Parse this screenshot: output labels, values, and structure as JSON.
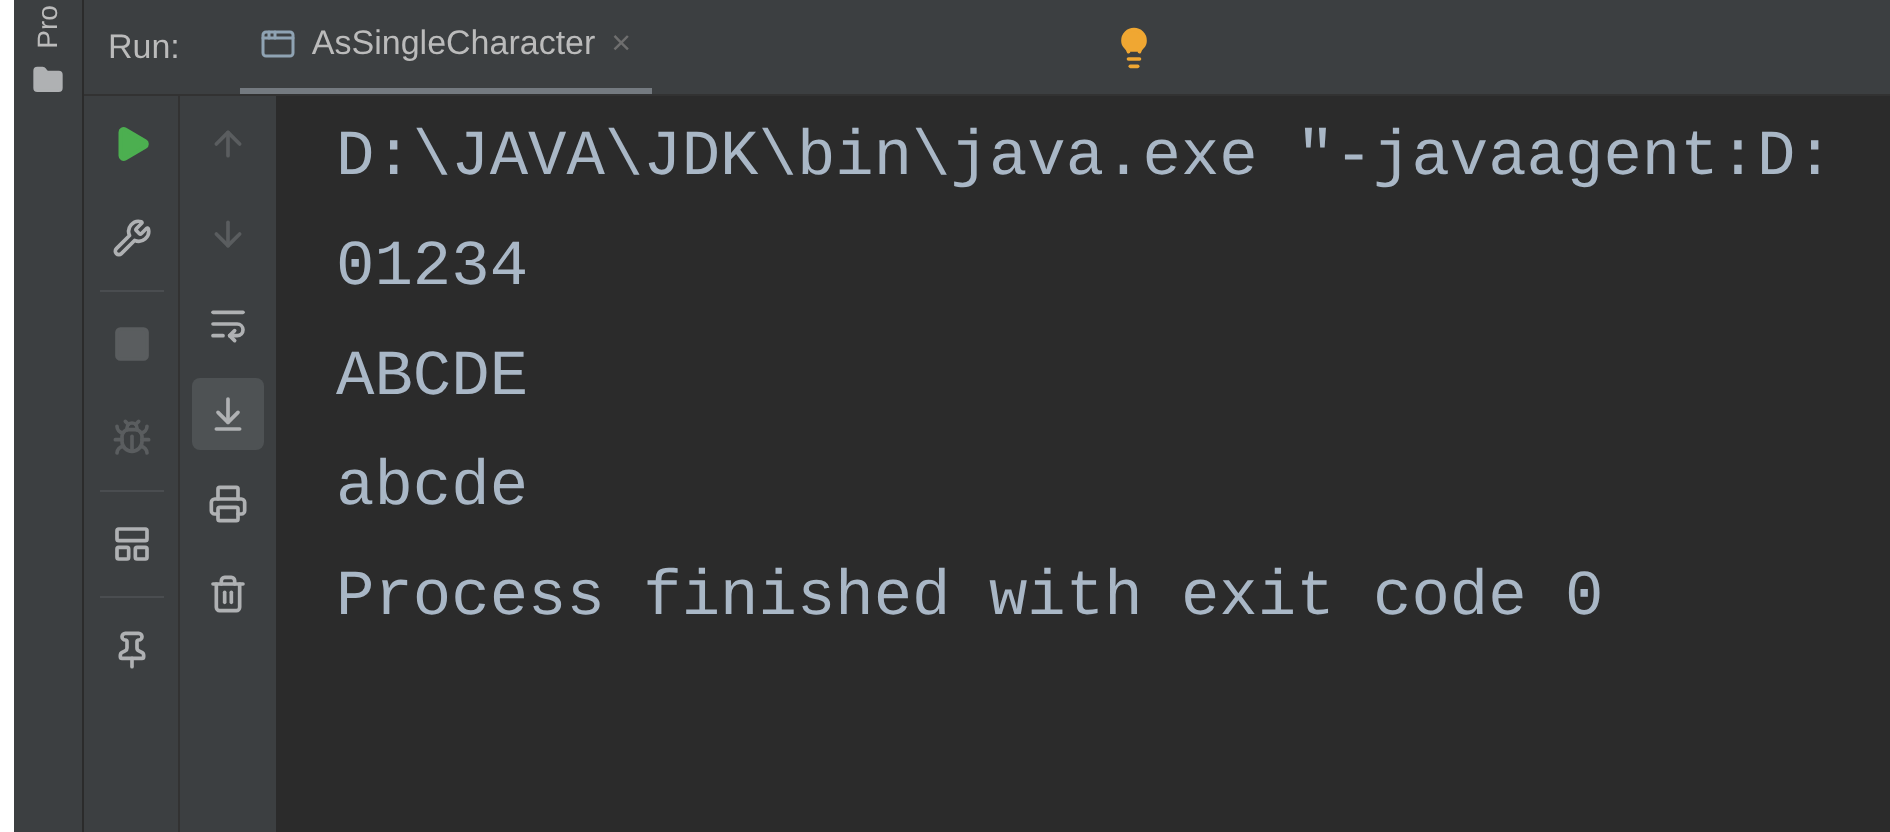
{
  "side_strip": {
    "label": "Pro"
  },
  "run_panel": {
    "title": "Run:",
    "tab": {
      "label": "AsSingleCharacter",
      "close": "×",
      "selected": true
    }
  },
  "left_toolbar": [
    [
      {
        "kind": "run",
        "disabled": false
      },
      {
        "kind": "settings",
        "disabled": false
      }
    ],
    [
      {
        "kind": "stop",
        "disabled": true
      },
      {
        "kind": "debug",
        "disabled": true
      }
    ],
    [
      {
        "kind": "layout",
        "disabled": false
      }
    ],
    [
      {
        "kind": "pin",
        "disabled": false
      }
    ]
  ],
  "right_toolbar": [
    {
      "kind": "up",
      "disabled": true,
      "selected": false
    },
    {
      "kind": "down",
      "disabled": true,
      "selected": false
    },
    {
      "kind": "wrap",
      "disabled": false,
      "selected": false
    },
    {
      "kind": "scroll-end",
      "disabled": false,
      "selected": true
    },
    {
      "kind": "print",
      "disabled": false,
      "selected": false
    },
    {
      "kind": "delete",
      "disabled": false,
      "selected": false
    }
  ],
  "console": {
    "lines": [
      "D:\\JAVA\\JDK\\bin\\java.exe \"-javaagent:D:",
      "01234",
      "ABCDE",
      "abcde",
      "Process finished with exit code 0"
    ]
  }
}
